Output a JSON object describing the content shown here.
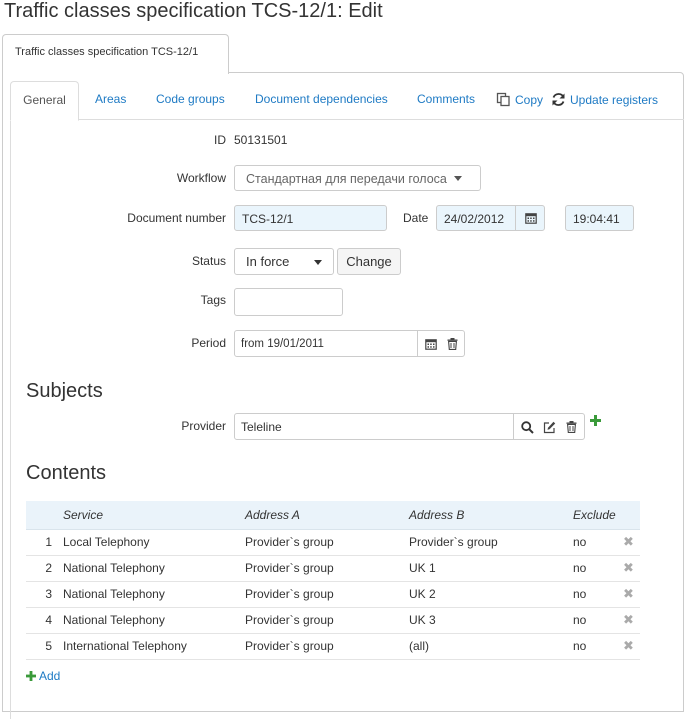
{
  "page": {
    "title": "Traffic classes specification TCS-12/1: Edit"
  },
  "document_tab": {
    "label": "Traffic classes specification TCS-12/1"
  },
  "tabs": {
    "general": "General",
    "areas": "Areas",
    "code_groups": "Code groups",
    "document_dependencies": "Document dependencies",
    "comments": "Comments",
    "copy": "Copy",
    "update_registers": "Update registers"
  },
  "form": {
    "id_label": "ID",
    "id_value": "50131501",
    "workflow_label": "Workflow",
    "workflow_value": "Стандартная для передачи голоса",
    "docnum_label": "Document number",
    "docnum_value": "TCS-12/1",
    "date_label": "Date",
    "date_value": "24/02/2012",
    "time_value": "19:04:41",
    "status_label": "Status",
    "status_value": "In force",
    "change_button": "Change",
    "tags_label": "Tags",
    "tags_value": "",
    "period_label": "Period",
    "period_value": "from 19/01/2011"
  },
  "subjects": {
    "heading": "Subjects",
    "provider_label": "Provider",
    "provider_value": "Teleline"
  },
  "contents": {
    "heading": "Contents",
    "columns": {
      "service": "Service",
      "address_a": "Address A",
      "address_b": "Address B",
      "exclude": "Exclude"
    },
    "rows": [
      {
        "num": "1",
        "service": "Local Telephony",
        "address_a": "Provider`s group",
        "address_b": "Provider`s group",
        "exclude": "no"
      },
      {
        "num": "2",
        "service": "National Telephony",
        "address_a": "Provider`s group",
        "address_b": "UK 1",
        "exclude": "no"
      },
      {
        "num": "3",
        "service": "National Telephony",
        "address_a": "Provider`s group",
        "address_b": "UK 2",
        "exclude": "no"
      },
      {
        "num": "4",
        "service": "National Telephony",
        "address_a": "Provider`s group",
        "address_b": "UK 3",
        "exclude": "no"
      },
      {
        "num": "5",
        "service": "International Telephony",
        "address_a": "Provider`s group",
        "address_b": "(all)",
        "exclude": "no"
      }
    ],
    "add_label": "Add"
  },
  "colors": {
    "link": "#1e7ac4",
    "add_green": "#3a9a3a",
    "header_bg": "#eaf3fa",
    "input_blue": "#eaf5fc"
  }
}
